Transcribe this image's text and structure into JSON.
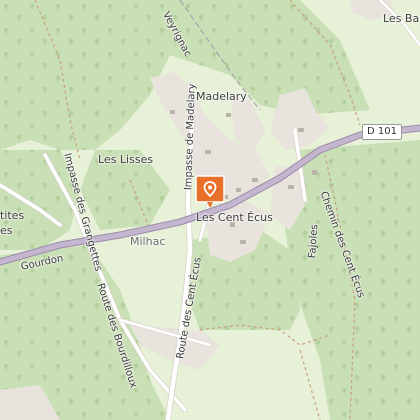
{
  "map": {
    "colors": {
      "background": "#e6f1d7",
      "forest": "#c9dfb5",
      "residential": "#e8e4dd",
      "major_road": "#b9a8c7",
      "minor_road": "#ffffff",
      "marker": "#e8702a"
    },
    "marker": {
      "icon": "map-pin-icon",
      "color": "#e8702a"
    },
    "shield": {
      "d101": "D 101"
    },
    "places": {
      "madelary": "Madelary",
      "les_lisses": "Les Lisses",
      "les_cent_ecus": "Les Cent Écus",
      "milhac": "Milhac",
      "les_barres_partial": "Les Bar",
      "petites_partial_1": "tites",
      "petites_partial_2": "es"
    },
    "roads": {
      "veyrignac": "Veyrignac",
      "impasse_madelary": "Impasse de Madelary",
      "impasse_grangettes": "Impasse des Grangettes",
      "route_bourdilloux": "Route des Bourdilloux",
      "route_cent_ecus": "Route des Cent Écus",
      "gourdon": "Gourdon",
      "fajoles": "Fajoles",
      "chemin_cent_ecus": "Chemin des Cent Écus"
    }
  }
}
